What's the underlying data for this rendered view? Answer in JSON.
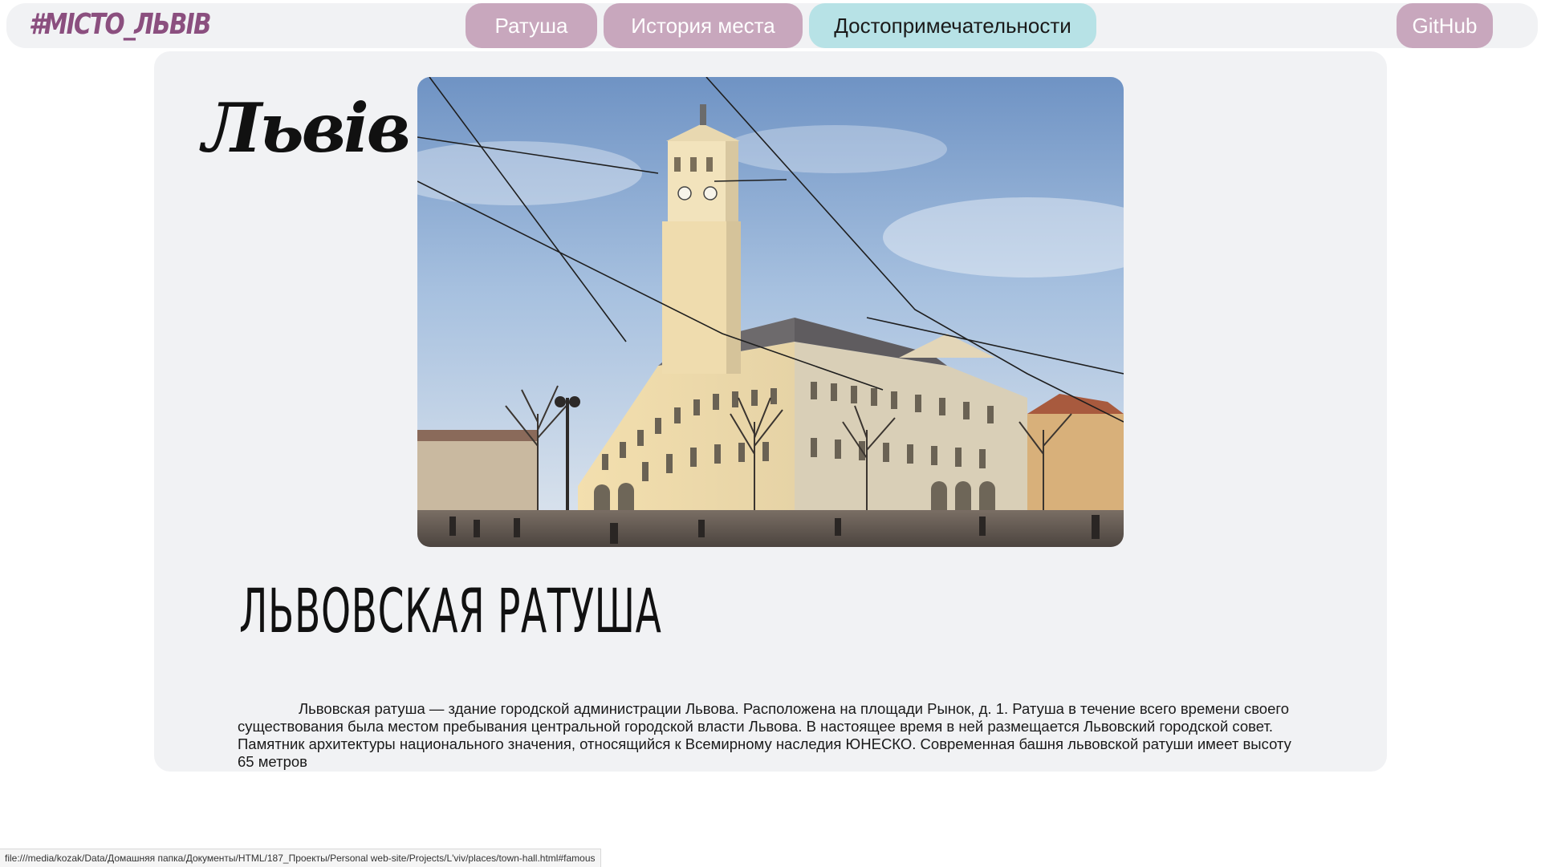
{
  "navbar": {
    "logo": "#МІСТО_ЛЬВІВ",
    "links": [
      {
        "label": "Ратуша"
      },
      {
        "label": "История места"
      },
      {
        "label": "Достопримечательности"
      }
    ],
    "github_label": "GitHub"
  },
  "card": {
    "city_script": "Львів",
    "photo_subject": "Lviv Town Hall tower and square",
    "heading": "ЛЬВОВСКАЯ РАТУША",
    "description": "Львовская ратуша — здание городской администрации Львова. Расположена на площади Рынок, д. 1. Ратуша в течение всего времени своего существования была местом пребывания центральной городской власти Львова. В настоящее время в ней размещается Львовский городской совет. Памятник архитектуры национального значения, относящийся к Всемирному наследия ЮНЕСКО. Современная башня львовской ратуши имеет высоту 65 метров"
  },
  "status_bar": {
    "url": "file:///media/kozak/Data/Домашняя папка/Документы/HTML/187_Проекты/Personal web-site/Projects/L'viv/places/town-hall.html#famous"
  },
  "colors": {
    "nav_pink": "#c8a7bd",
    "nav_active_cyan": "#b7e2e6",
    "logo": "#8b4f7f",
    "panel_bg": "#f1f2f4"
  }
}
